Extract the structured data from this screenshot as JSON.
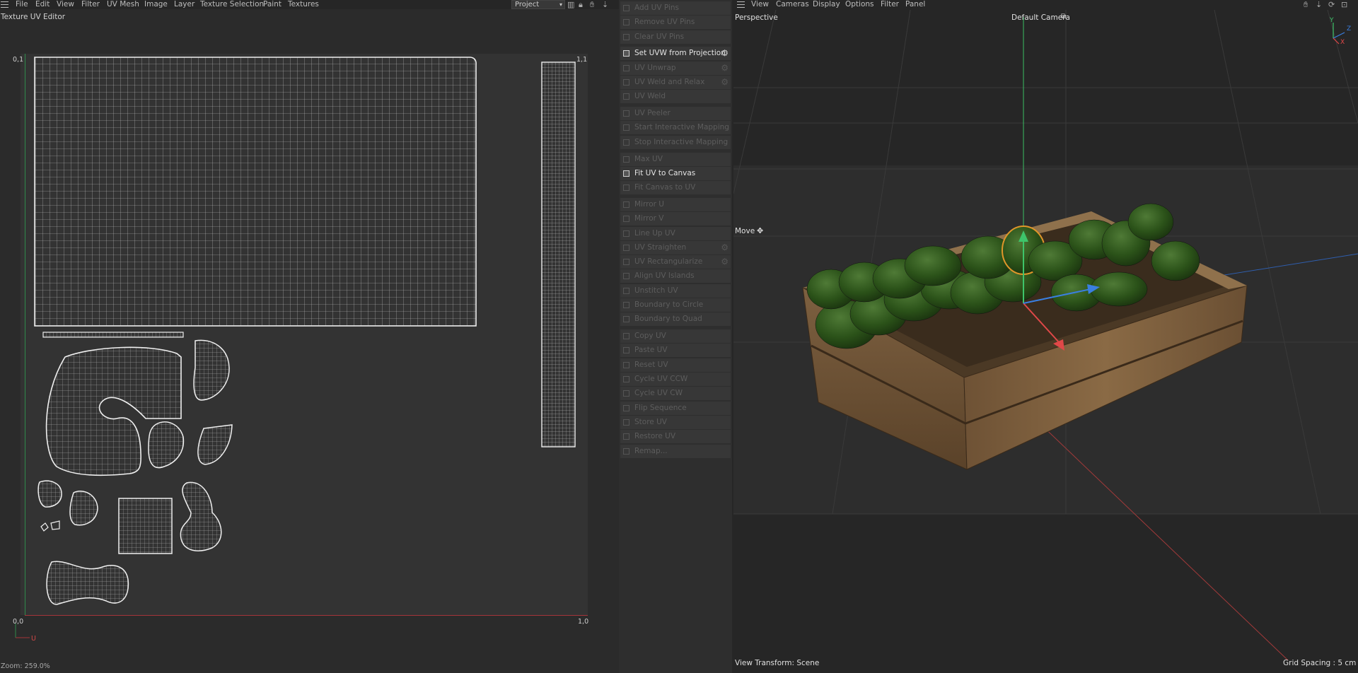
{
  "uv_editor": {
    "menu": [
      "File",
      "Edit",
      "View",
      "Filter",
      "UV Mesh",
      "Image",
      "Layer",
      "Texture Selection",
      "Paint",
      "Textures"
    ],
    "title": "Texture UV Editor",
    "project_dropdown": "Project",
    "corners": {
      "top_left": "0,1",
      "top_right": "1,1",
      "bottom_left": "0,0",
      "bottom_right": "1,0"
    },
    "axis_u": "U",
    "zoom": "Zoom: 259.0%",
    "colors": {
      "v_axis": "#2f8a4a",
      "u_axis": "#a5343a",
      "wire": "#e6e6e6"
    }
  },
  "commands": {
    "groups": [
      [
        {
          "label": "Add UV Pins",
          "enabled": false,
          "gear": false
        },
        {
          "label": "Remove UV Pins",
          "enabled": false,
          "gear": false
        },
        {
          "label": "Clear UV Pins",
          "enabled": false,
          "gear": false
        }
      ],
      [
        {
          "label": "Set UVW from Projection",
          "enabled": true,
          "gear": true
        },
        {
          "label": "UV Unwrap",
          "enabled": false,
          "gear": true
        },
        {
          "label": "UV Weld and Relax",
          "enabled": false,
          "gear": true
        },
        {
          "label": "UV Weld",
          "enabled": false,
          "gear": false
        }
      ],
      [
        {
          "label": "UV Peeler",
          "enabled": false,
          "gear": false
        },
        {
          "label": "Start Interactive Mapping",
          "enabled": false,
          "gear": false
        },
        {
          "label": "Stop Interactive Mapping",
          "enabled": false,
          "gear": false
        }
      ],
      [
        {
          "label": "Max UV",
          "enabled": false,
          "gear": false
        },
        {
          "label": "Fit UV to Canvas",
          "enabled": true,
          "gear": false
        },
        {
          "label": "Fit Canvas to UV",
          "enabled": false,
          "gear": false
        }
      ],
      [
        {
          "label": "Mirror U",
          "enabled": false,
          "gear": false
        },
        {
          "label": "Mirror V",
          "enabled": false,
          "gear": false
        },
        {
          "label": "Line Up UV",
          "enabled": false,
          "gear": false
        },
        {
          "label": "UV Straighten",
          "enabled": false,
          "gear": true
        },
        {
          "label": "UV Rectangularize",
          "enabled": false,
          "gear": true
        },
        {
          "label": "Align UV Islands",
          "enabled": false,
          "gear": false
        },
        {
          "label": "Unstitch UV",
          "enabled": false,
          "gear": false
        },
        {
          "label": "Boundary to Circle",
          "enabled": false,
          "gear": false
        },
        {
          "label": "Boundary to Quad",
          "enabled": false,
          "gear": false
        }
      ],
      [
        {
          "label": "Copy UV",
          "enabled": false,
          "gear": false
        },
        {
          "label": "Paste UV",
          "enabled": false,
          "gear": false
        },
        {
          "label": "Reset UV",
          "enabled": false,
          "gear": false
        },
        {
          "label": "Cycle UV CCW",
          "enabled": false,
          "gear": false
        },
        {
          "label": "Cycle UV CW",
          "enabled": false,
          "gear": false
        },
        {
          "label": "Flip Sequence",
          "enabled": false,
          "gear": false
        },
        {
          "label": "Store UV",
          "enabled": false,
          "gear": false
        },
        {
          "label": "Restore UV",
          "enabled": false,
          "gear": false
        },
        {
          "label": "Remap...",
          "enabled": false,
          "gear": false
        }
      ]
    ]
  },
  "viewport": {
    "menu": [
      "View",
      "Cameras",
      "Display",
      "Options",
      "Filter",
      "Panel"
    ],
    "perspective": "Perspective",
    "camera": "Default Camera",
    "tool": "Move",
    "view_transform": "View Transform: Scene",
    "grid_spacing": "Grid Spacing : 5 cm",
    "axes": {
      "y": "Y",
      "z": "Z",
      "x": "X"
    },
    "colors": {
      "x_axis": "#e04848",
      "y_axis": "#3ec46a",
      "z_axis": "#3a7fe0",
      "selection_outline": "#e0962a",
      "wood": "#8a6a44",
      "fruit": "#2f5a20"
    }
  }
}
